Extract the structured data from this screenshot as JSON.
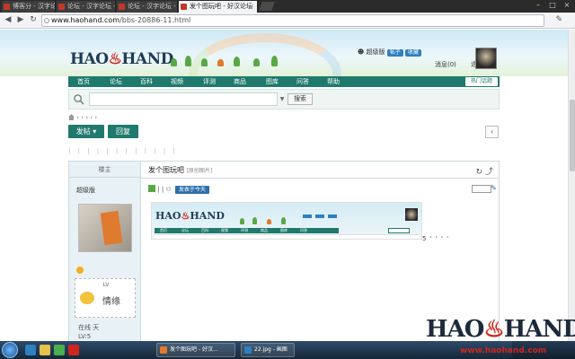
{
  "browser": {
    "tabs": [
      {
        "label": "博客分 - 汉字论坛 -"
      },
      {
        "label": "论坛 - 汉字论坛 - 汉字"
      },
      {
        "label": "论坛 - 汉字论坛 - 汉字"
      },
      {
        "label": "发个图玩吧 - 好汉论坛"
      }
    ],
    "url_host": "www.haohand.com",
    "url_path": "/bbs-20886-11.html"
  },
  "header": {
    "logo_pre": "HAO",
    "logo_post": "HAND",
    "user_name": "超级版",
    "user_badge_1": "帖子",
    "user_badge_2": "收藏",
    "user_line_2": "消息(0)",
    "user_suffix": "退"
  },
  "nav": {
    "items": [
      "首页",
      "论坛",
      "百科",
      "视频",
      "评测",
      "商品",
      "图库",
      "问答",
      "帮助"
    ],
    "hot_button": "热门话题"
  },
  "search": {
    "button": "搜索",
    "placeholder": ""
  },
  "toolbar": {
    "post_button": "发帖",
    "reply_button": "回复",
    "back_button": "‹"
  },
  "thread": {
    "sidebar_head": "楼主",
    "author": "超级版",
    "medal_text": "",
    "card_level": "LV",
    "card_name": "情缘",
    "info_1": "在线 天",
    "info_2": "LV:5",
    "post_title": "发个图玩吧",
    "post_tag": "[原创图片]",
    "meta_pill": "发表于今天",
    "trailing": "5 ' ' ' '"
  },
  "watermark": {
    "logo_pre": "HAO",
    "logo_post": "HAND",
    "url": "www.haohand.com"
  },
  "taskbar": {
    "items": [
      {
        "label": "发个图玩吧 - 好汉..."
      },
      {
        "label": "22.jpg - 画图"
      }
    ]
  },
  "colors": {
    "nav_green": "#1f7a6d",
    "brand_red": "#d0251c",
    "logo_navy": "#1d3c5a"
  }
}
